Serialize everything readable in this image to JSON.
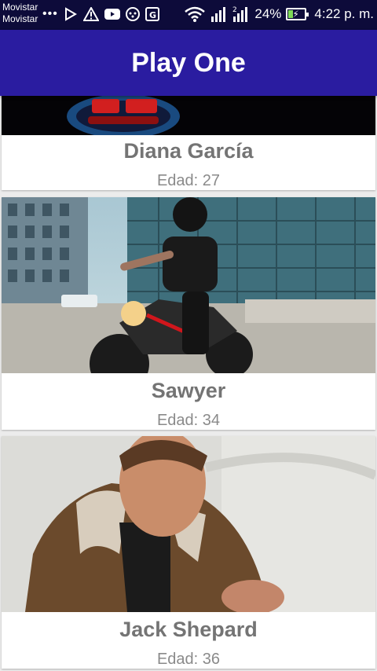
{
  "status_bar": {
    "carrier_1": "Movistar",
    "carrier_2": "Movistar",
    "battery": "24%",
    "time": "4:22 p. m."
  },
  "app": {
    "title": "Play One",
    "colors": {
      "app_bar": "#2a1ca0",
      "status_bar": "#0d0b3a"
    }
  },
  "profiles": [
    {
      "name": "Diana García",
      "age": "Edad: 27",
      "image": "robot-visor-photo"
    },
    {
      "name": "Sawyer",
      "age": "Edad: 34",
      "image": "motorcycle-rider-photo"
    },
    {
      "name": "Jack Shepard",
      "age": "Edad: 36",
      "image": "man-leather-jacket-photo"
    }
  ]
}
